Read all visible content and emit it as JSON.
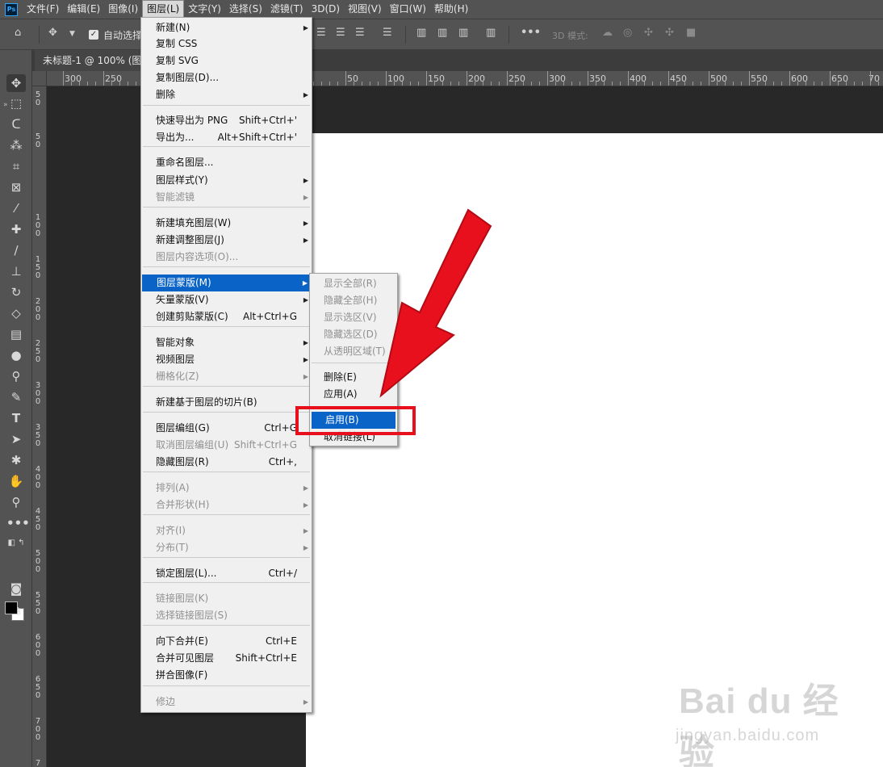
{
  "menubar": {
    "logo": "Ps",
    "items": [
      "文件(F)",
      "编辑(E)",
      "图像(I)",
      "图层(L)",
      "文字(Y)",
      "选择(S)",
      "滤镜(T)",
      "3D(D)",
      "视图(V)",
      "窗口(W)",
      "帮助(H)"
    ],
    "active_index": 3
  },
  "optionsbar": {
    "auto_select_label": "自动选择",
    "mode_3d_label": "3D 模式:"
  },
  "document": {
    "tab_title": "未标题-1 @ 100% (图层",
    "canvas_color": "#ffffff"
  },
  "rulers": {
    "horizontal_labels": [
      "300",
      "250",
      "50",
      "100",
      "150",
      "200",
      "250",
      "300",
      "350",
      "400",
      "450",
      "500",
      "550",
      "600",
      "650",
      "70"
    ],
    "vertical_labels": [
      "5|0",
      "5|0",
      "1|0|0",
      "1|5|0",
      "2|0|0",
      "2|5|0",
      "3|0|0",
      "3|5|0",
      "4|0|0",
      "4|5|0",
      "5|0|0",
      "5|5|0",
      "6|0|0",
      "6|5|0",
      "7|0|0",
      "7|5|0"
    ]
  },
  "layer_menu": {
    "items": [
      {
        "label": "新建(N)",
        "shortcut": "",
        "submenu": true,
        "disabled": false
      },
      {
        "label": "复制 CSS",
        "shortcut": "",
        "submenu": false,
        "disabled": false
      },
      {
        "label": "复制 SVG",
        "shortcut": "",
        "submenu": false,
        "disabled": false
      },
      {
        "label": "复制图层(D)...",
        "shortcut": "",
        "submenu": false,
        "disabled": false
      },
      {
        "label": "删除",
        "shortcut": "",
        "submenu": true,
        "disabled": false
      },
      {
        "label": "快速导出为 PNG",
        "shortcut": "Shift+Ctrl+'",
        "submenu": false,
        "disabled": false
      },
      {
        "label": "导出为...",
        "shortcut": "Alt+Shift+Ctrl+'",
        "submenu": false,
        "disabled": false
      },
      {
        "label": "重命名图层...",
        "shortcut": "",
        "submenu": false,
        "disabled": false
      },
      {
        "label": "图层样式(Y)",
        "shortcut": "",
        "submenu": true,
        "disabled": false
      },
      {
        "label": "智能滤镜",
        "shortcut": "",
        "submenu": true,
        "disabled": true
      },
      {
        "label": "新建填充图层(W)",
        "shortcut": "",
        "submenu": true,
        "disabled": false
      },
      {
        "label": "新建调整图层(J)",
        "shortcut": "",
        "submenu": true,
        "disabled": false
      },
      {
        "label": "图层内容选项(O)...",
        "shortcut": "",
        "submenu": false,
        "disabled": true
      },
      {
        "label": "图层蒙版(M)",
        "shortcut": "",
        "submenu": true,
        "disabled": false,
        "highlighted": true
      },
      {
        "label": "矢量蒙版(V)",
        "shortcut": "",
        "submenu": true,
        "disabled": false
      },
      {
        "label": "创建剪贴蒙版(C)",
        "shortcut": "Alt+Ctrl+G",
        "submenu": false,
        "disabled": false
      },
      {
        "label": "智能对象",
        "shortcut": "",
        "submenu": true,
        "disabled": false
      },
      {
        "label": "视频图层",
        "shortcut": "",
        "submenu": true,
        "disabled": false
      },
      {
        "label": "栅格化(Z)",
        "shortcut": "",
        "submenu": true,
        "disabled": true
      },
      {
        "label": "新建基于图层的切片(B)",
        "shortcut": "",
        "submenu": false,
        "disabled": false
      },
      {
        "label": "图层编组(G)",
        "shortcut": "Ctrl+G",
        "submenu": false,
        "disabled": false
      },
      {
        "label": "取消图层编组(U)",
        "shortcut": "Shift+Ctrl+G",
        "submenu": false,
        "disabled": true
      },
      {
        "label": "隐藏图层(R)",
        "shortcut": "Ctrl+,",
        "submenu": false,
        "disabled": false
      },
      {
        "label": "排列(A)",
        "shortcut": "",
        "submenu": true,
        "disabled": true
      },
      {
        "label": "合并形状(H)",
        "shortcut": "",
        "submenu": true,
        "disabled": true
      },
      {
        "label": "对齐(I)",
        "shortcut": "",
        "submenu": true,
        "disabled": true
      },
      {
        "label": "分布(T)",
        "shortcut": "",
        "submenu": true,
        "disabled": true
      },
      {
        "label": "锁定图层(L)...",
        "shortcut": "Ctrl+/",
        "submenu": false,
        "disabled": false
      },
      {
        "label": "链接图层(K)",
        "shortcut": "",
        "submenu": false,
        "disabled": true
      },
      {
        "label": "选择链接图层(S)",
        "shortcut": "",
        "submenu": false,
        "disabled": true
      },
      {
        "label": "向下合并(E)",
        "shortcut": "Ctrl+E",
        "submenu": false,
        "disabled": false
      },
      {
        "label": "合并可见图层",
        "shortcut": "Shift+Ctrl+E",
        "submenu": false,
        "disabled": false
      },
      {
        "label": "拼合图像(F)",
        "shortcut": "",
        "submenu": false,
        "disabled": false
      },
      {
        "label": "修边",
        "shortcut": "",
        "submenu": true,
        "disabled": true
      }
    ]
  },
  "mask_submenu": {
    "items": [
      {
        "label": "显示全部(R)",
        "disabled": true
      },
      {
        "label": "隐藏全部(H)",
        "disabled": true
      },
      {
        "label": "显示选区(V)",
        "disabled": true
      },
      {
        "label": "隐藏选区(D)",
        "disabled": true
      },
      {
        "label": "从透明区域(T)",
        "disabled": true
      },
      {
        "label": "删除(E)",
        "disabled": false
      },
      {
        "label": "应用(A)",
        "disabled": false
      },
      {
        "label": "启用(B)",
        "disabled": false,
        "highlighted": true
      },
      {
        "label": "取消链接(L)",
        "disabled": false
      }
    ]
  },
  "annotation": {
    "highlight_color": "#e8101d",
    "arrow_color": "#e8101d"
  },
  "watermark": {
    "brand": "Bai du 经验",
    "url": "jingyan.baidu.com"
  },
  "colors": {
    "menu_highlight": "#0a64c8",
    "panel_bg": "#535353",
    "workspace_bg": "#282828"
  }
}
